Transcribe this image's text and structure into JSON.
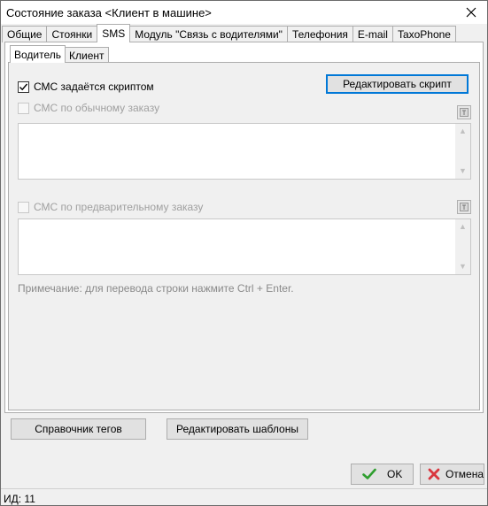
{
  "window": {
    "title": "Состояние заказа <Клиент в машине>"
  },
  "tabs": [
    {
      "label": "Общие"
    },
    {
      "label": "Стоянки"
    },
    {
      "label": "SMS"
    },
    {
      "label": "Модуль \"Связь с водителями\""
    },
    {
      "label": "Телефония"
    },
    {
      "label": "E-mail"
    },
    {
      "label": "TaxoPhone"
    }
  ],
  "active_tab": "SMS",
  "subtabs": [
    {
      "label": "Водитель"
    },
    {
      "label": "Клиент"
    }
  ],
  "active_subtab": "Водитель",
  "driver": {
    "script_checkbox": {
      "label": "СМС задаётся скриптом",
      "checked": true
    },
    "edit_script_button": "Редактировать скрипт",
    "regular_checkbox": {
      "label": "СМС по обычному заказу",
      "checked": false,
      "enabled": false
    },
    "regular_text": "",
    "preorder_checkbox": {
      "label": "СМС по предварительному заказу",
      "checked": false,
      "enabled": false
    },
    "preorder_text": "",
    "note": "Примечание: для перевода строки нажмите Ctrl + Enter."
  },
  "bottom_buttons": {
    "tags_reference": "Справочник тегов",
    "edit_templates": "Редактировать шаблоны"
  },
  "dialog_buttons": {
    "ok": "OK",
    "cancel": "Отмена"
  },
  "statusbar": {
    "text": "ИД: 11"
  },
  "colors": {
    "accent": "#0078d7",
    "ok_green": "#2e9e2e",
    "cancel_red": "#d9363e"
  }
}
